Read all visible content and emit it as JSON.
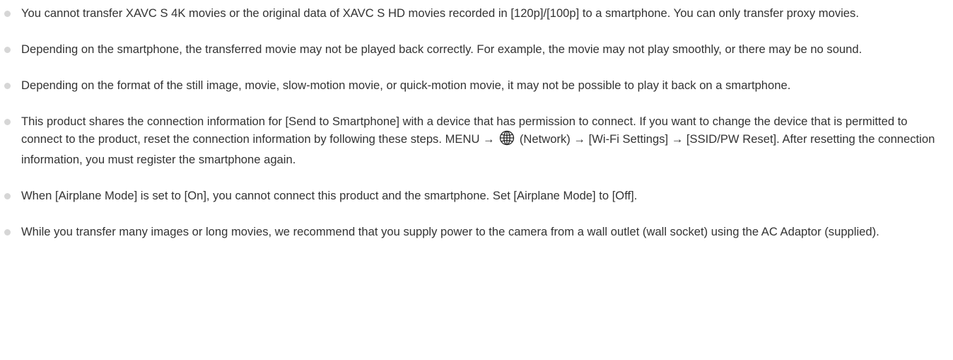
{
  "notes": [
    {
      "text": "You cannot transfer XAVC S 4K movies or the original data of XAVC S HD movies recorded in [120p]/[100p] to a smartphone. You can only transfer proxy movies."
    },
    {
      "text": "Depending on the smartphone, the transferred movie may not be played back correctly. For example, the movie may not play smoothly, or there may be no sound."
    },
    {
      "text": "Depending on the format of the still image, movie, slow-motion movie, or quick-motion movie, it may not be possible to play it back on a smartphone."
    },
    {
      "text_before_icon": "This product shares the connection information for [Send to Smartphone] with a device that has permission to connect. If you want to change the device that is permitted to connect to the product, reset the connection information by following these steps. MENU →",
      "icon": "network-globe-icon",
      "text_after_icon": "(Network) → [Wi-Fi Settings] → [SSID/PW Reset]. After resetting the connection information, you must register the smartphone again."
    },
    {
      "text": "When [Airplane Mode] is set to [On], you cannot connect this product and the smartphone. Set [Airplane Mode] to [Off]."
    },
    {
      "text": "While you transfer many images or long movies, we recommend that you supply power to the camera from a wall outlet (wall socket) using the AC Adaptor (supplied)."
    }
  ]
}
